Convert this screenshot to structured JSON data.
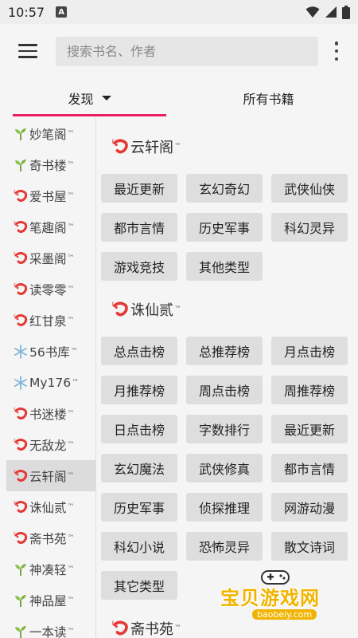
{
  "status_bar": {
    "time": "10:57",
    "a_label": "A"
  },
  "search": {
    "placeholder": "搜索书名、作者"
  },
  "tabs": [
    {
      "label": "发现",
      "active": true
    },
    {
      "label": "所有书籍",
      "active": false
    }
  ],
  "sidebar": {
    "items": [
      {
        "label": "妙笔阁",
        "icon": "sprout-icon"
      },
      {
        "label": "奇书楼",
        "icon": "sprout-icon"
      },
      {
        "label": "爱书屋",
        "icon": "shrimp-icon"
      },
      {
        "label": "笔趣阁",
        "icon": "shrimp-icon"
      },
      {
        "label": "采墨阁",
        "icon": "shrimp-icon"
      },
      {
        "label": "读零零",
        "icon": "shrimp-icon"
      },
      {
        "label": "红甘泉",
        "icon": "shrimp-icon"
      },
      {
        "label": "56书库",
        "icon": "snowflake-icon"
      },
      {
        "label": "My176",
        "icon": "snowflake-icon"
      },
      {
        "label": "书迷楼",
        "icon": "shrimp-icon"
      },
      {
        "label": "无敌龙",
        "icon": "shrimp-icon"
      },
      {
        "label": "云轩阁",
        "icon": "shrimp-icon",
        "active": true
      },
      {
        "label": "诛仙贰",
        "icon": "shrimp-icon"
      },
      {
        "label": "斋书苑",
        "icon": "shrimp-icon"
      },
      {
        "label": "神凑轻",
        "icon": "sprout-icon"
      },
      {
        "label": "神品屋",
        "icon": "sprout-icon"
      },
      {
        "label": "一本读",
        "icon": "sprout-icon"
      }
    ],
    "tm": "™"
  },
  "sections": [
    {
      "title": "云轩阁",
      "tags": [
        "最近更新",
        "玄幻奇幻",
        "武侠仙侠",
        "都市言情",
        "历史军事",
        "科幻灵异",
        "游戏竞技",
        "其他类型"
      ]
    },
    {
      "title": "诛仙贰",
      "tags": [
        "总点击榜",
        "总推荐榜",
        "月点击榜",
        "月推荐榜",
        "周点击榜",
        "周推荐榜",
        "日点击榜",
        "字数排行",
        "最近更新",
        "玄幻魔法",
        "武侠修真",
        "都市言情",
        "历史军事",
        "侦探推理",
        "网游动漫",
        "科幻小说",
        "恐怖灵异",
        "散文诗词",
        "其它类型"
      ]
    },
    {
      "title": "斋书苑",
      "tags": []
    }
  ],
  "watermark": {
    "text": "宝贝游戏网",
    "url": "baobeiy.com"
  },
  "colors": {
    "accent": "#e91e63",
    "tag_bg": "#dedede"
  }
}
